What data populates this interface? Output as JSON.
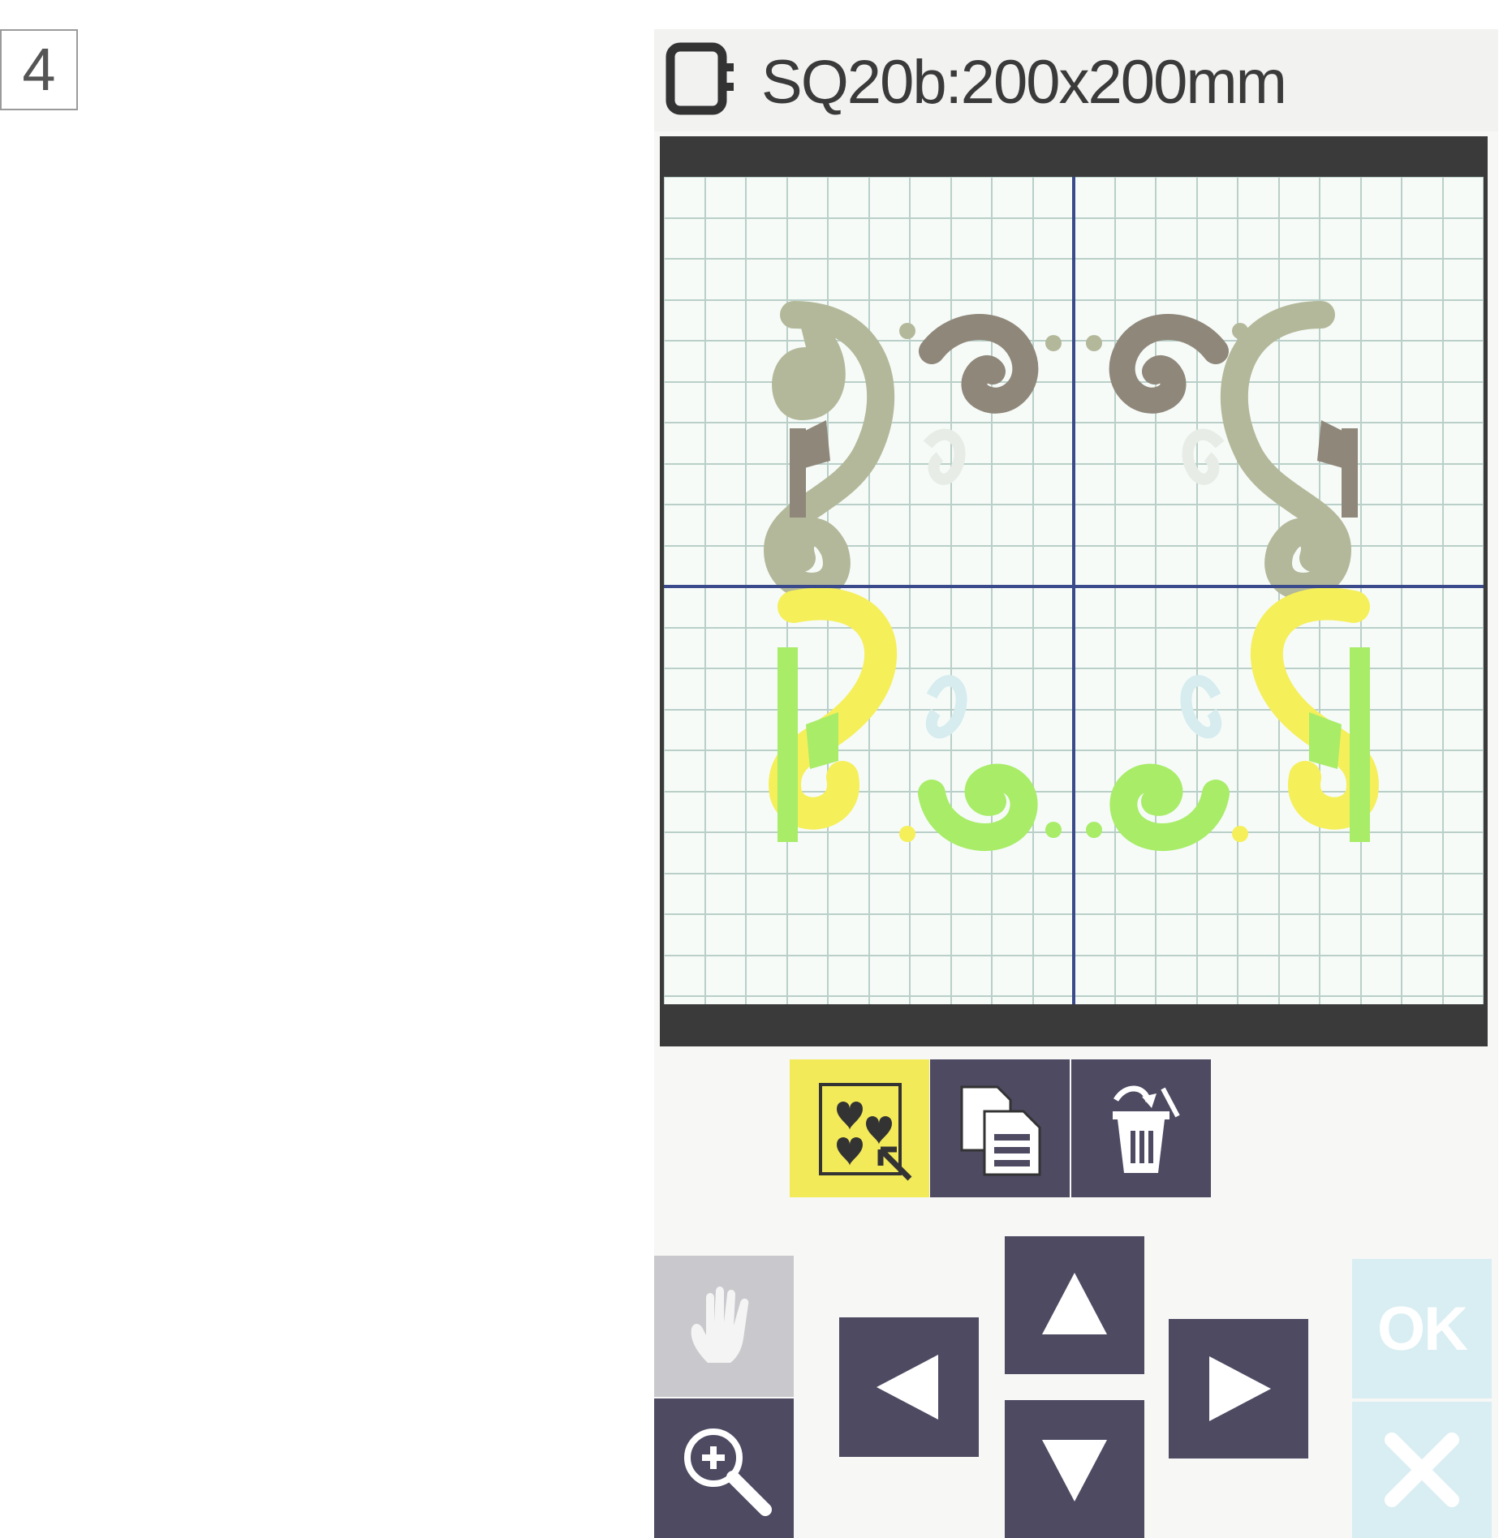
{
  "step": {
    "number": "4"
  },
  "header": {
    "hoop_icon": "hoop-icon",
    "hoop_name": "SQ20b:200x200mm"
  },
  "canvas": {
    "design_colors": {
      "olive_light": "#b3b89a",
      "olive_dark": "#8f877a",
      "yellow": "#f5ef5a",
      "green": "#a8ec68",
      "pale": "#d6ecee"
    },
    "grid_color": "#b9cfc8",
    "center_line_color": "#3a4a8a"
  },
  "toolbar": {
    "select_icon": "select-all-hearts-icon",
    "copy_icon": "copy-icon",
    "delete_icon": "delete-icon",
    "selected_color": "#f3ea5a",
    "button_color": "#4d4a62"
  },
  "controls": {
    "hand_icon": "hand-icon",
    "zoom_icon": "zoom-in-icon",
    "ok_label": "OK",
    "cancel_icon": "close-icon",
    "disabled_color": "#d9eef2"
  }
}
